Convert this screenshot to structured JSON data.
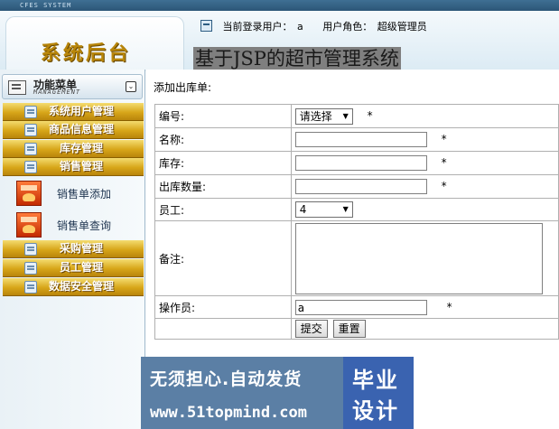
{
  "top": {
    "system_tag": "CFES SYSTEM"
  },
  "header": {
    "logo": "系统后台",
    "current_user_label": "当前登录用户：",
    "current_user": "a",
    "role_label": "用户角色：",
    "role": "超级管理员",
    "site_title": "基于JSP的超市管理系统"
  },
  "sidebar": {
    "heading": "功能菜单",
    "heading_sub": "MANAGEMENT",
    "items": [
      {
        "label": "系统用户管理"
      },
      {
        "label": "商品信息管理"
      },
      {
        "label": "库存管理"
      },
      {
        "label": "销售管理"
      },
      {
        "label": "采购管理"
      },
      {
        "label": "员工管理"
      },
      {
        "label": "数据安全管理"
      }
    ],
    "sub_items": [
      {
        "label": "销售单添加"
      },
      {
        "label": "销售单查询"
      }
    ]
  },
  "form": {
    "title": "添加出库单:",
    "required_mark": "*",
    "rows": {
      "code": {
        "label": "编号:",
        "value": "请选择"
      },
      "name": {
        "label": "名称:",
        "value": ""
      },
      "stock": {
        "label": "库存:",
        "value": ""
      },
      "quantity": {
        "label": "出库数量:",
        "value": ""
      },
      "staff": {
        "label": "员工:",
        "value": "4"
      },
      "remark": {
        "label": "备注:",
        "value": ""
      },
      "operator": {
        "label": "操作员:",
        "value": "a"
      }
    },
    "submit_label": "提交",
    "reset_label": "重置"
  },
  "watermark": {
    "line1": "无须担心.自动发货",
    "line2": "www.51topmind.com",
    "badge1": "毕业",
    "badge2": "设计"
  }
}
